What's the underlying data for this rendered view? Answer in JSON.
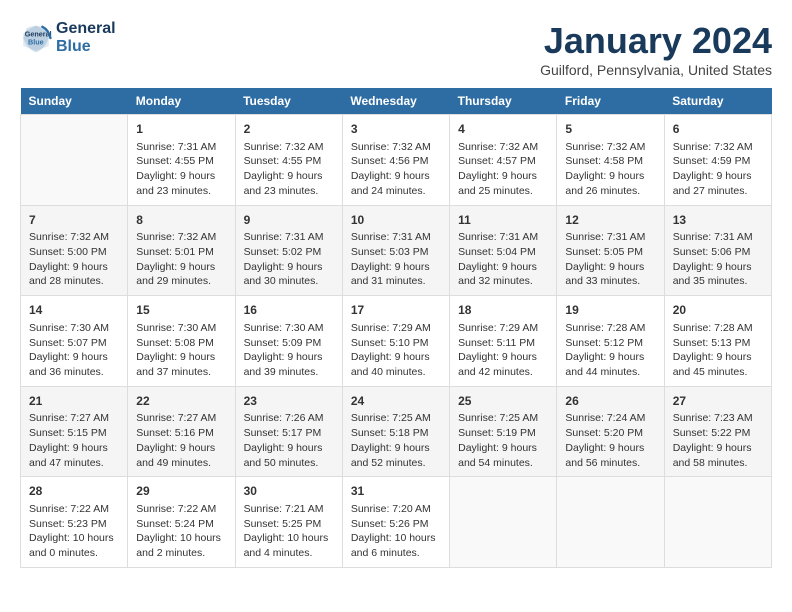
{
  "logo": {
    "line1": "General",
    "line2": "Blue"
  },
  "title": "January 2024",
  "location": "Guilford, Pennsylvania, United States",
  "headers": [
    "Sunday",
    "Monday",
    "Tuesday",
    "Wednesday",
    "Thursday",
    "Friday",
    "Saturday"
  ],
  "weeks": [
    [
      {
        "day": "",
        "content": ""
      },
      {
        "day": "1",
        "content": "Sunrise: 7:31 AM\nSunset: 4:55 PM\nDaylight: 9 hours\nand 23 minutes."
      },
      {
        "day": "2",
        "content": "Sunrise: 7:32 AM\nSunset: 4:55 PM\nDaylight: 9 hours\nand 23 minutes."
      },
      {
        "day": "3",
        "content": "Sunrise: 7:32 AM\nSunset: 4:56 PM\nDaylight: 9 hours\nand 24 minutes."
      },
      {
        "day": "4",
        "content": "Sunrise: 7:32 AM\nSunset: 4:57 PM\nDaylight: 9 hours\nand 25 minutes."
      },
      {
        "day": "5",
        "content": "Sunrise: 7:32 AM\nSunset: 4:58 PM\nDaylight: 9 hours\nand 26 minutes."
      },
      {
        "day": "6",
        "content": "Sunrise: 7:32 AM\nSunset: 4:59 PM\nDaylight: 9 hours\nand 27 minutes."
      }
    ],
    [
      {
        "day": "7",
        "content": "Sunrise: 7:32 AM\nSunset: 5:00 PM\nDaylight: 9 hours\nand 28 minutes."
      },
      {
        "day": "8",
        "content": "Sunrise: 7:32 AM\nSunset: 5:01 PM\nDaylight: 9 hours\nand 29 minutes."
      },
      {
        "day": "9",
        "content": "Sunrise: 7:31 AM\nSunset: 5:02 PM\nDaylight: 9 hours\nand 30 minutes."
      },
      {
        "day": "10",
        "content": "Sunrise: 7:31 AM\nSunset: 5:03 PM\nDaylight: 9 hours\nand 31 minutes."
      },
      {
        "day": "11",
        "content": "Sunrise: 7:31 AM\nSunset: 5:04 PM\nDaylight: 9 hours\nand 32 minutes."
      },
      {
        "day": "12",
        "content": "Sunrise: 7:31 AM\nSunset: 5:05 PM\nDaylight: 9 hours\nand 33 minutes."
      },
      {
        "day": "13",
        "content": "Sunrise: 7:31 AM\nSunset: 5:06 PM\nDaylight: 9 hours\nand 35 minutes."
      }
    ],
    [
      {
        "day": "14",
        "content": "Sunrise: 7:30 AM\nSunset: 5:07 PM\nDaylight: 9 hours\nand 36 minutes."
      },
      {
        "day": "15",
        "content": "Sunrise: 7:30 AM\nSunset: 5:08 PM\nDaylight: 9 hours\nand 37 minutes."
      },
      {
        "day": "16",
        "content": "Sunrise: 7:30 AM\nSunset: 5:09 PM\nDaylight: 9 hours\nand 39 minutes."
      },
      {
        "day": "17",
        "content": "Sunrise: 7:29 AM\nSunset: 5:10 PM\nDaylight: 9 hours\nand 40 minutes."
      },
      {
        "day": "18",
        "content": "Sunrise: 7:29 AM\nSunset: 5:11 PM\nDaylight: 9 hours\nand 42 minutes."
      },
      {
        "day": "19",
        "content": "Sunrise: 7:28 AM\nSunset: 5:12 PM\nDaylight: 9 hours\nand 44 minutes."
      },
      {
        "day": "20",
        "content": "Sunrise: 7:28 AM\nSunset: 5:13 PM\nDaylight: 9 hours\nand 45 minutes."
      }
    ],
    [
      {
        "day": "21",
        "content": "Sunrise: 7:27 AM\nSunset: 5:15 PM\nDaylight: 9 hours\nand 47 minutes."
      },
      {
        "day": "22",
        "content": "Sunrise: 7:27 AM\nSunset: 5:16 PM\nDaylight: 9 hours\nand 49 minutes."
      },
      {
        "day": "23",
        "content": "Sunrise: 7:26 AM\nSunset: 5:17 PM\nDaylight: 9 hours\nand 50 minutes."
      },
      {
        "day": "24",
        "content": "Sunrise: 7:25 AM\nSunset: 5:18 PM\nDaylight: 9 hours\nand 52 minutes."
      },
      {
        "day": "25",
        "content": "Sunrise: 7:25 AM\nSunset: 5:19 PM\nDaylight: 9 hours\nand 54 minutes."
      },
      {
        "day": "26",
        "content": "Sunrise: 7:24 AM\nSunset: 5:20 PM\nDaylight: 9 hours\nand 56 minutes."
      },
      {
        "day": "27",
        "content": "Sunrise: 7:23 AM\nSunset: 5:22 PM\nDaylight: 9 hours\nand 58 minutes."
      }
    ],
    [
      {
        "day": "28",
        "content": "Sunrise: 7:22 AM\nSunset: 5:23 PM\nDaylight: 10 hours\nand 0 minutes."
      },
      {
        "day": "29",
        "content": "Sunrise: 7:22 AM\nSunset: 5:24 PM\nDaylight: 10 hours\nand 2 minutes."
      },
      {
        "day": "30",
        "content": "Sunrise: 7:21 AM\nSunset: 5:25 PM\nDaylight: 10 hours\nand 4 minutes."
      },
      {
        "day": "31",
        "content": "Sunrise: 7:20 AM\nSunset: 5:26 PM\nDaylight: 10 hours\nand 6 minutes."
      },
      {
        "day": "",
        "content": ""
      },
      {
        "day": "",
        "content": ""
      },
      {
        "day": "",
        "content": ""
      }
    ]
  ]
}
